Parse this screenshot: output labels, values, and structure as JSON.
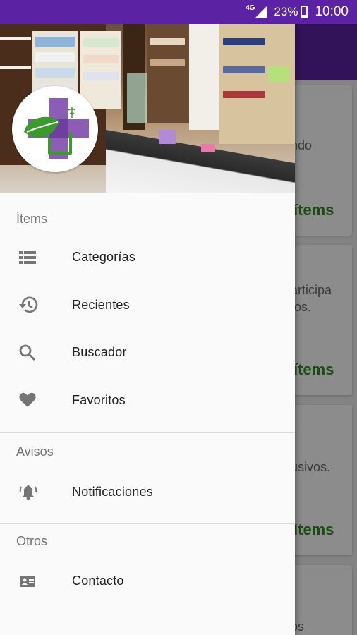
{
  "status_bar": {
    "network": "4G",
    "battery": "23%",
    "time": "10:00"
  },
  "background": {
    "cards": [
      {
        "desc_lines": [
          "ndo"
        ],
        "link": "ítems"
      },
      {
        "desc_lines": [
          "articipa",
          "tos."
        ],
        "link": "ítems"
      },
      {
        "desc_lines": [
          "usivos."
        ],
        "link": "ítems"
      },
      {
        "desc_lines": [
          "os"
        ],
        "link": ""
      }
    ]
  },
  "drawer": {
    "sections": [
      {
        "label": "Ítems",
        "items": [
          {
            "label": "Categorías",
            "icon": "list-icon"
          },
          {
            "label": "Recientes",
            "icon": "history-icon"
          },
          {
            "label": "Buscador",
            "icon": "search-icon"
          },
          {
            "label": "Favoritos",
            "icon": "heart-icon"
          }
        ]
      },
      {
        "label": "Avisos",
        "items": [
          {
            "label": "Notificaciones",
            "icon": "bell-icon"
          }
        ]
      },
      {
        "label": "Otros",
        "items": [
          {
            "label": "Contacto",
            "icon": "contact-card-icon"
          }
        ]
      }
    ]
  },
  "colors": {
    "primary": "#5b22a3",
    "accent_green": "#2e8b1f",
    "logo_purple": "#8b5db5",
    "logo_green": "#3a9a2a"
  }
}
